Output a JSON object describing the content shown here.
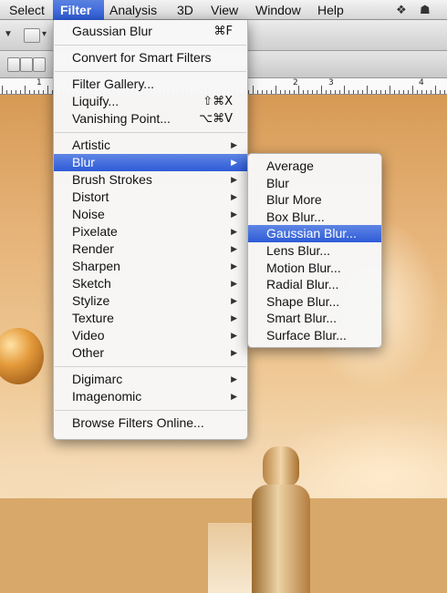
{
  "menubar": {
    "items": [
      "Select",
      "Filter",
      "Analysis",
      "3D",
      "View",
      "Window",
      "Help"
    ],
    "active": "Filter",
    "status_icons": [
      "dropbox-icon",
      "hat-icon"
    ]
  },
  "ruler": {
    "labels": [
      "1",
      "2",
      "3",
      "4"
    ]
  },
  "filter_menu": {
    "groups": [
      [
        {
          "label": "Gaussian Blur",
          "shortcut": "⌘F"
        }
      ],
      [
        {
          "label": "Convert for Smart Filters"
        }
      ],
      [
        {
          "label": "Filter Gallery..."
        },
        {
          "label": "Liquify...",
          "shortcut": "⇧⌘X"
        },
        {
          "label": "Vanishing Point...",
          "shortcut": "⌥⌘V"
        }
      ],
      [
        {
          "label": "Artistic",
          "submenu": true
        },
        {
          "label": "Blur",
          "submenu": true,
          "highlighted": true
        },
        {
          "label": "Brush Strokes",
          "submenu": true
        },
        {
          "label": "Distort",
          "submenu": true
        },
        {
          "label": "Noise",
          "submenu": true
        },
        {
          "label": "Pixelate",
          "submenu": true
        },
        {
          "label": "Render",
          "submenu": true
        },
        {
          "label": "Sharpen",
          "submenu": true
        },
        {
          "label": "Sketch",
          "submenu": true
        },
        {
          "label": "Stylize",
          "submenu": true
        },
        {
          "label": "Texture",
          "submenu": true
        },
        {
          "label": "Video",
          "submenu": true
        },
        {
          "label": "Other",
          "submenu": true
        }
      ],
      [
        {
          "label": "Digimarc",
          "submenu": true
        },
        {
          "label": "Imagenomic",
          "submenu": true
        }
      ],
      [
        {
          "label": "Browse Filters Online..."
        }
      ]
    ]
  },
  "blur_submenu": {
    "items": [
      {
        "label": "Average"
      },
      {
        "label": "Blur"
      },
      {
        "label": "Blur More"
      },
      {
        "label": "Box Blur..."
      },
      {
        "label": "Gaussian Blur...",
        "highlighted": true
      },
      {
        "label": "Lens Blur..."
      },
      {
        "label": "Motion Blur..."
      },
      {
        "label": "Radial Blur..."
      },
      {
        "label": "Shape Blur..."
      },
      {
        "label": "Smart Blur..."
      },
      {
        "label": "Surface Blur..."
      }
    ]
  },
  "colors": {
    "highlight": "#2e5bd7",
    "menu_bg": "#f7f7f7",
    "canvas": "#e6b47a"
  }
}
